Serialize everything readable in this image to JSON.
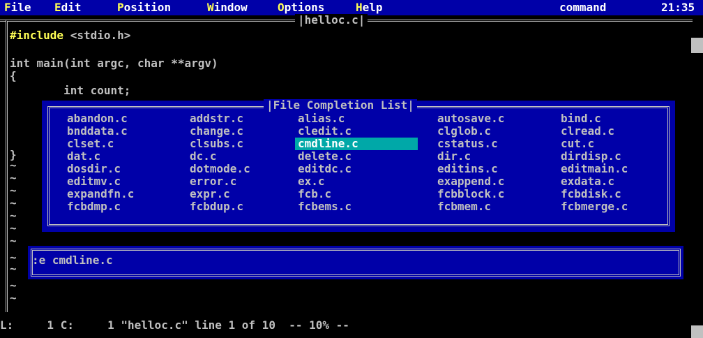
{
  "menu": {
    "file": {
      "hot": "F",
      "rest": "ile"
    },
    "edit": {
      "hot": "E",
      "rest": "dit"
    },
    "position": {
      "hot": "P",
      "rest": "osition"
    },
    "window": {
      "hot": "W",
      "rest": "indow"
    },
    "options": {
      "hot": "O",
      "rest": "ptions"
    },
    "help": {
      "hot": "H",
      "rest": "elp"
    },
    "mode": "command",
    "clock": "21:35"
  },
  "window": {
    "title": "helloc.c"
  },
  "code": {
    "line1_kw": "#include",
    "line1_rest": " <stdio.h>",
    "line2": "int main(int argc, char **argv)",
    "line3": "{",
    "line4": "        int count;",
    "close_brace": "}",
    "tilde": "~"
  },
  "completion": {
    "title": "File Completion List",
    "selected": "cmdline.c",
    "rows": [
      [
        "abandon.c",
        "addstr.c",
        "alias.c",
        "autosave.c",
        "bind.c"
      ],
      [
        "bnddata.c",
        "change.c",
        "cledit.c",
        "clglob.c",
        "clread.c"
      ],
      [
        "clset.c",
        "clsubs.c",
        "cmdline.c",
        "cstatus.c",
        "cut.c"
      ],
      [
        "dat.c",
        "dc.c",
        "delete.c",
        "dir.c",
        "dirdisp.c"
      ],
      [
        "dosdir.c",
        "dotmode.c",
        "editdc.c",
        "editins.c",
        "editmain.c"
      ],
      [
        "editmv.c",
        "error.c",
        "ex.c",
        "exappend.c",
        "exdata.c"
      ],
      [
        "expandfn.c",
        "expr.c",
        "fcb.c",
        "fcbblock.c",
        "fcbdisk.c"
      ],
      [
        "fcbdmp.c",
        "fcbdup.c",
        "fcbems.c",
        "fcbmem.c",
        "fcbmerge.c"
      ]
    ]
  },
  "command_line": {
    "text": ":e cmdline.c"
  },
  "status": {
    "text": "L:     1 C:     1 \"helloc.c\" line 1 of 10  -- 10% --"
  }
}
